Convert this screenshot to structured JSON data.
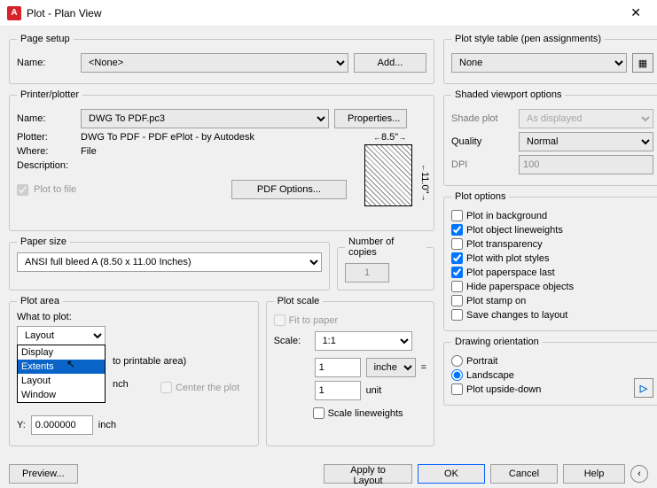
{
  "title": "Plot - Plan View",
  "pageSetup": {
    "legend": "Page setup",
    "nameLabel": "Name:",
    "nameValue": "<None>",
    "addBtn": "Add..."
  },
  "printer": {
    "legend": "Printer/plotter",
    "nameLabel": "Name:",
    "nameValue": "DWG To PDF.pc3",
    "propsBtn": "Properties...",
    "plotterLabel": "Plotter:",
    "plotterValue": "DWG To PDF - PDF ePlot - by Autodesk",
    "whereLabel": "Where:",
    "whereValue": "File",
    "descLabel": "Description:",
    "plotToFile": "Plot to file",
    "pdfOptions": "PDF Options...",
    "dimW": "8.5\"",
    "dimH": "11.0\""
  },
  "paperSize": {
    "legend": "Paper size",
    "value": "ANSI full bleed A (8.50 x 11.00 Inches)"
  },
  "copies": {
    "legend": "Number of copies",
    "value": "1"
  },
  "plotArea": {
    "legend": "Plot area",
    "whatLabel": "What to plot:",
    "selected": "Layout",
    "options": [
      "Display",
      "Extents",
      "Layout",
      "Window"
    ],
    "highlighted": "Extents",
    "printableArea": "to printable area)",
    "centerPlot": "Center the plot",
    "unit": "inch",
    "yLabel": "Y:",
    "yValue": "0.000000"
  },
  "plotScale": {
    "legend": "Plot scale",
    "fitLabel": "Fit to paper",
    "scaleLabel": "Scale:",
    "scaleValue": "1:1",
    "num1": "1",
    "unit1": "inches",
    "eq": "=",
    "num2": "1",
    "unit2": "unit",
    "scaleLW": "Scale lineweights"
  },
  "styleTable": {
    "legend": "Plot style table (pen assignments)",
    "value": "None"
  },
  "shaded": {
    "legend": "Shaded viewport options",
    "shadeLabel": "Shade plot",
    "shadeValue": "As displayed",
    "qualityLabel": "Quality",
    "qualityValue": "Normal",
    "dpiLabel": "DPI",
    "dpiValue": "100"
  },
  "plotOptions": {
    "legend": "Plot options",
    "bg": "Plot in background",
    "lw": "Plot object lineweights",
    "trans": "Plot transparency",
    "styles": "Plot with plot styles",
    "paperspace": "Plot paperspace last",
    "hide": "Hide paperspace objects",
    "stamp": "Plot stamp on",
    "save": "Save changes to layout"
  },
  "orientation": {
    "legend": "Drawing orientation",
    "portrait": "Portrait",
    "landscape": "Landscape",
    "upside": "Plot upside-down"
  },
  "footer": {
    "preview": "Preview...",
    "apply": "Apply to Layout",
    "ok": "OK",
    "cancel": "Cancel",
    "help": "Help"
  }
}
